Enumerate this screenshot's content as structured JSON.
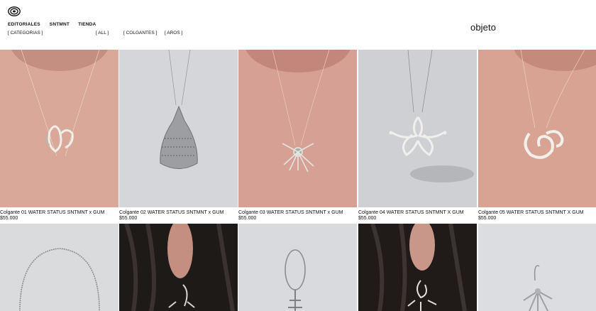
{
  "header": {
    "nav": [
      "EDITORIALES",
      "SNTMNT",
      "TIENDA"
    ],
    "filters": [
      "[ CATEGORIAS ]",
      "[ ALL ]",
      "[ COLGANTES ]",
      "[ AROS ]"
    ],
    "brand": "objeto"
  },
  "products": [
    {
      "title": "Colgante 01 WATER STATUS SNTMNT x GUM",
      "price": "$55.000",
      "bg": "#d9a898"
    },
    {
      "title": "Colgante 02 WATER STATUS SNTMNT x GUM",
      "price": "$55.000",
      "bg": "#d5d6da"
    },
    {
      "title": "Colgante 03 WATER STATUS SNTMNT x GUM",
      "price": "$55.000",
      "bg": "#d6a194"
    },
    {
      "title": "Colgante 04 WATER STATUS SNTMNT X GUM",
      "price": "$55.000",
      "bg": "#cfd0d4"
    },
    {
      "title": "Colgante 05 WATER STATUS SNTMNT X GUM",
      "price": "$55.000",
      "bg": "#d8a393"
    }
  ],
  "row2_bg": [
    "#dadbdd",
    "#1e1a18",
    "#d9dade",
    "#201b19",
    "#dcdde1"
  ]
}
